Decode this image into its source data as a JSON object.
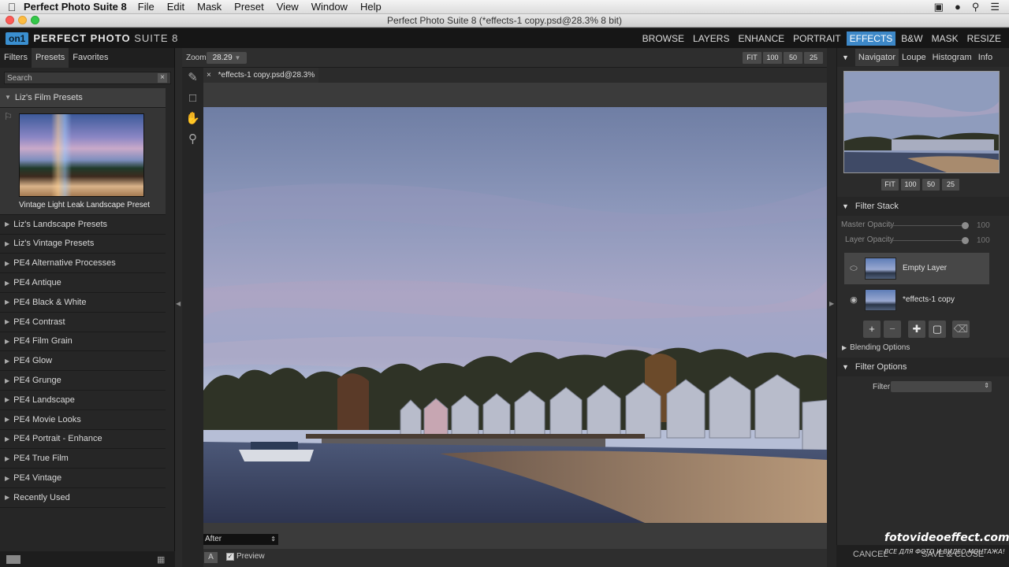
{
  "menubar": {
    "app_name": "Perfect Photo Suite 8",
    "items": [
      "File",
      "Edit",
      "Mask",
      "Preset",
      "View",
      "Window",
      "Help"
    ]
  },
  "window": {
    "title": "Perfect Photo Suite 8 (*effects-1 copy.psd@28.3% 8 bit)"
  },
  "header": {
    "logo_mark": "on1",
    "logo_text_bold": "PERFECT PHOTO",
    "logo_text_rest": " SUITE 8",
    "modules": [
      "BROWSE",
      "LAYERS",
      "ENHANCE",
      "PORTRAIT",
      "EFFECTS",
      "B&W",
      "MASK",
      "RESIZE"
    ],
    "active_module": "EFFECTS"
  },
  "left_panel": {
    "tabs": [
      "Filters",
      "Presets",
      "Favorites"
    ],
    "active_tab": "Presets",
    "search_placeholder": "Search",
    "open_category": "Liz's Film Presets",
    "thumbnail_caption": "Vintage Light Leak Landscape Preset",
    "categories": [
      "Liz's Landscape Presets",
      "Liz's Vintage Presets",
      "PE4 Alternative Processes",
      "PE4 Antique",
      "PE4 Black & White",
      "PE4 Contrast",
      "PE4 Film Grain",
      "PE4 Glow",
      "PE4 Grunge",
      "PE4 Landscape",
      "PE4 Movie Looks",
      "PE4 Portrait - Enhance",
      "PE4 True Film",
      "PE4 Vintage",
      "Recently Used"
    ]
  },
  "center": {
    "zoom_label": "Zoom",
    "zoom_value": "28.29",
    "zoom_buttons": [
      "FIT",
      "100",
      "50",
      "25"
    ],
    "doc_tab": "*effects-1 copy.psd@28.3% 8 bit",
    "view_mode": "After",
    "preview_label": "Preview"
  },
  "right_panel": {
    "nav_tabs": [
      "Navigator",
      "Loupe",
      "Histogram",
      "Info"
    ],
    "active_nav_tab": "Navigator",
    "nav_zoom_buttons": [
      "FIT",
      "100",
      "50",
      "25"
    ],
    "filter_stack_title": "Filter Stack",
    "master_opacity_label": "Master Opacity",
    "master_opacity_value": "100",
    "layer_opacity_label": "Layer Opacity",
    "layer_opacity_value": "100",
    "layers": [
      "Empty Layer",
      "*effects-1 copy"
    ],
    "blending_options": "Blending Options",
    "filter_options_title": "Filter Options",
    "filter_label": "Filter",
    "cancel_label": "CANCEL",
    "save_label": "SAVE & CLOSE"
  },
  "watermark": {
    "line1": "fotovideoeffect.com",
    "line2": "ВСЕ ДЛЯ ФОТО И ВИДЕО МОНТАЖА!"
  }
}
